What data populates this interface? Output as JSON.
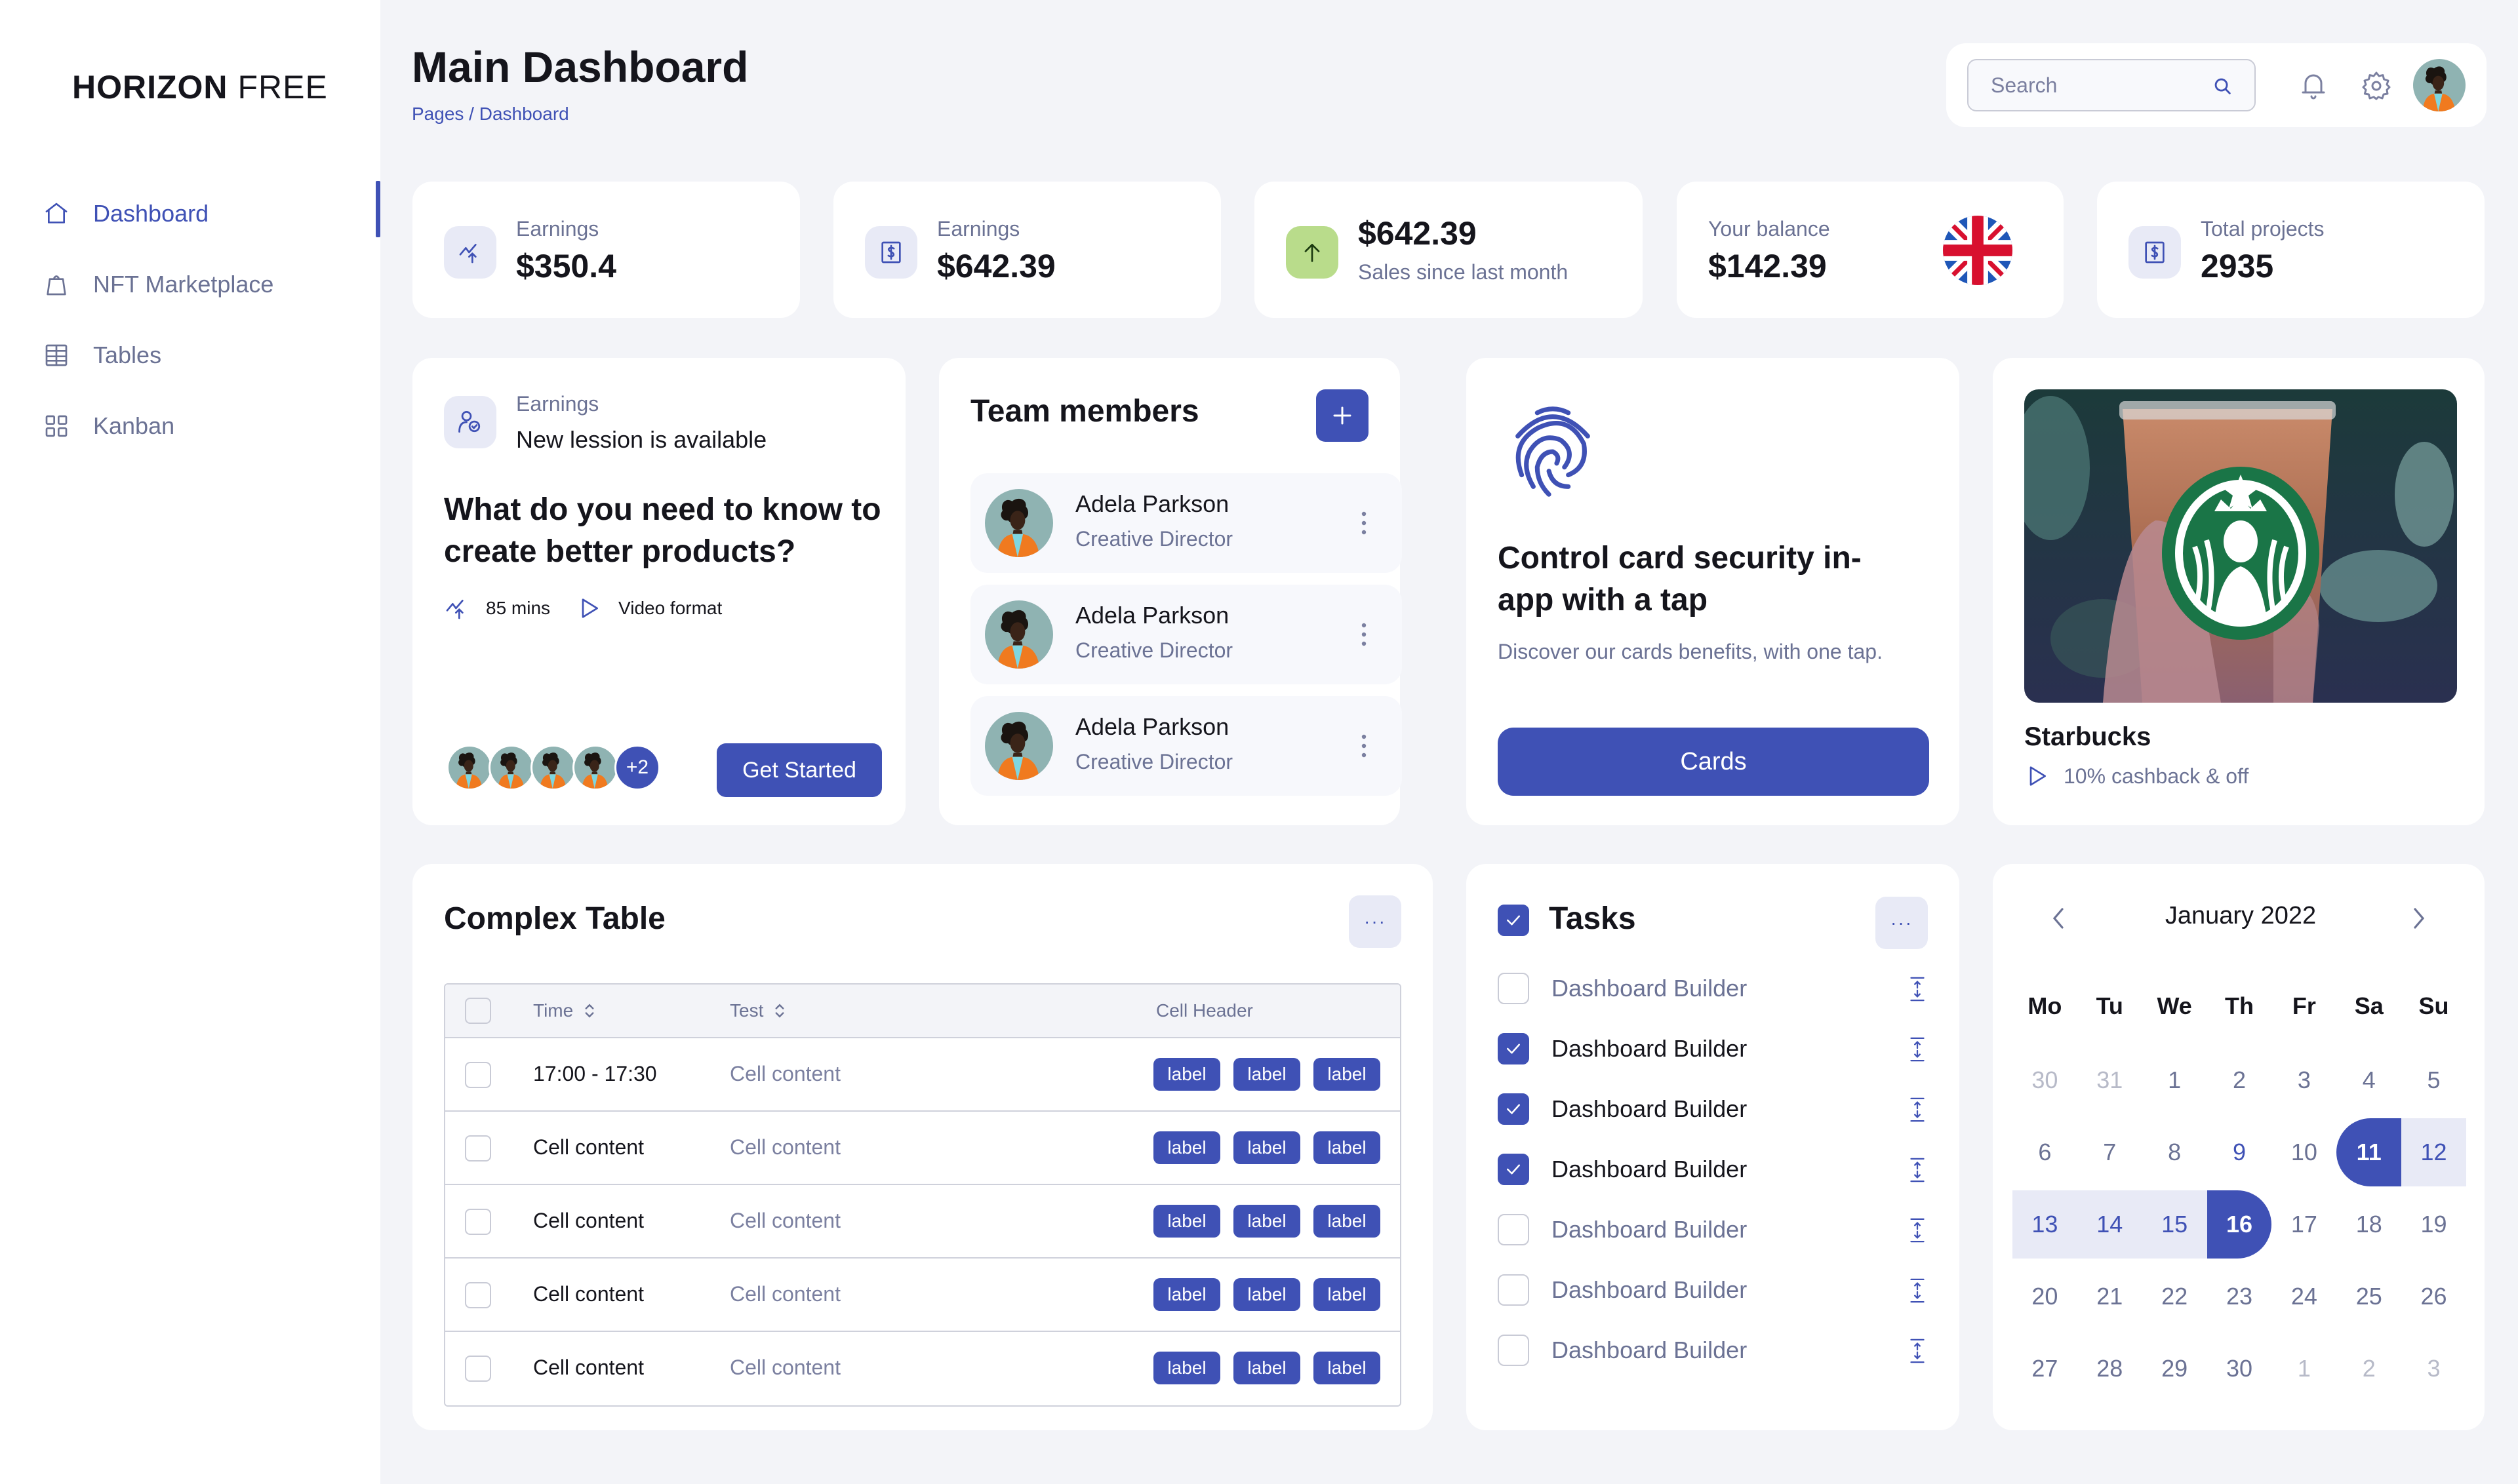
{
  "brand": {
    "bold": "HORIZON",
    "light": "FREE"
  },
  "sidebar": {
    "items": [
      {
        "label": "Dashboard",
        "icon": "home-icon",
        "active": true
      },
      {
        "label": "NFT Marketplace",
        "icon": "shopping-bag-icon",
        "active": false
      },
      {
        "label": "Tables",
        "icon": "table-icon",
        "active": false
      },
      {
        "label": "Kanban",
        "icon": "grid-icon",
        "active": false
      }
    ]
  },
  "header": {
    "title": "Main Dashboard",
    "breadcrumb": "Pages / Dashboard",
    "search_placeholder": "Search"
  },
  "stats": [
    {
      "label": "Earnings",
      "value": "$350.4",
      "icon": "chart-up-icon"
    },
    {
      "label": "Earnings",
      "value": "$642.39",
      "icon": "dollar-icon"
    },
    {
      "value": "$642.39",
      "sub": "Sales since last month",
      "icon": "arrow-up-icon"
    },
    {
      "label": "Your balance",
      "value": "$142.39",
      "icon": "uk-flag-icon"
    },
    {
      "label": "Total projects",
      "value": "2935",
      "icon": "dollar-icon"
    }
  ],
  "lesson": {
    "label": "Earnings",
    "subtitle": "New lession is available",
    "title": "What do you need to know to create better products?",
    "duration": "85 mins",
    "format": "Video format",
    "extra_count": "+2",
    "cta": "Get Started"
  },
  "team": {
    "title": "Team members",
    "members": [
      {
        "name": "Adela Parkson",
        "role": "Creative Director"
      },
      {
        "name": "Adela Parkson",
        "role": "Creative Director"
      },
      {
        "name": "Adela Parkson",
        "role": "Creative Director"
      }
    ]
  },
  "security": {
    "title": "Control card security in-app with a tap",
    "description": "Discover our cards benefits, with one tap.",
    "cta": "Cards"
  },
  "promo": {
    "title": "Starbucks",
    "subtitle": "10% cashback & off"
  },
  "complex_table": {
    "title": "Complex Table",
    "more_label": "···",
    "columns": [
      "Time",
      "Test",
      "Cell Header"
    ],
    "rows": [
      {
        "c1": "17:00 - 17:30",
        "c2": "Cell content",
        "labels": [
          "label",
          "label",
          "label"
        ]
      },
      {
        "c1": "Cell content",
        "c2": "Cell content",
        "labels": [
          "label",
          "label",
          "label"
        ]
      },
      {
        "c1": "Cell content",
        "c2": "Cell content",
        "labels": [
          "label",
          "label",
          "label"
        ]
      },
      {
        "c1": "Cell content",
        "c2": "Cell content",
        "labels": [
          "label",
          "label",
          "label"
        ]
      },
      {
        "c1": "Cell content",
        "c2": "Cell content",
        "labels": [
          "label",
          "label",
          "label"
        ]
      }
    ]
  },
  "tasks": {
    "title": "Tasks",
    "more_label": "···",
    "items": [
      {
        "label": "Dashboard Builder",
        "done": false
      },
      {
        "label": "Dashboard Builder",
        "done": true
      },
      {
        "label": "Dashboard Builder",
        "done": true
      },
      {
        "label": "Dashboard Builder",
        "done": true
      },
      {
        "label": "Dashboard Builder",
        "done": false
      },
      {
        "label": "Dashboard Builder",
        "done": false
      },
      {
        "label": "Dashboard Builder",
        "done": false
      }
    ]
  },
  "calendar": {
    "month": "January 2022",
    "weekdays": [
      "Mo",
      "Tu",
      "We",
      "Th",
      "Fr",
      "Sa",
      "Su"
    ],
    "weeks": [
      [
        {
          "d": "30",
          "s": "muted"
        },
        {
          "d": "31",
          "s": "muted"
        },
        {
          "d": "1"
        },
        {
          "d": "2"
        },
        {
          "d": "3"
        },
        {
          "d": "4"
        },
        {
          "d": "5"
        }
      ],
      [
        {
          "d": "6"
        },
        {
          "d": "7"
        },
        {
          "d": "8"
        },
        {
          "d": "9",
          "s": "accent"
        },
        {
          "d": "10"
        },
        {
          "d": "11",
          "s": "start"
        },
        {
          "d": "12",
          "s": "range"
        }
      ],
      [
        {
          "d": "13",
          "s": "range"
        },
        {
          "d": "14",
          "s": "range"
        },
        {
          "d": "15",
          "s": "range"
        },
        {
          "d": "16",
          "s": "end"
        },
        {
          "d": "17"
        },
        {
          "d": "18"
        },
        {
          "d": "19"
        }
      ],
      [
        {
          "d": "20"
        },
        {
          "d": "21"
        },
        {
          "d": "22"
        },
        {
          "d": "23"
        },
        {
          "d": "24"
        },
        {
          "d": "25"
        },
        {
          "d": "26"
        }
      ],
      [
        {
          "d": "27"
        },
        {
          "d": "28"
        },
        {
          "d": "29"
        },
        {
          "d": "30"
        },
        {
          "d": "1",
          "s": "muted"
        },
        {
          "d": "2",
          "s": "muted"
        },
        {
          "d": "3",
          "s": "muted"
        }
      ]
    ]
  },
  "colors": {
    "accent": "#3f51b5",
    "accent_light": "#e8eaf6",
    "text": "#15151c",
    "muted": "#6b7294",
    "background": "#f3f4f8",
    "green": "#b9dc8b"
  }
}
